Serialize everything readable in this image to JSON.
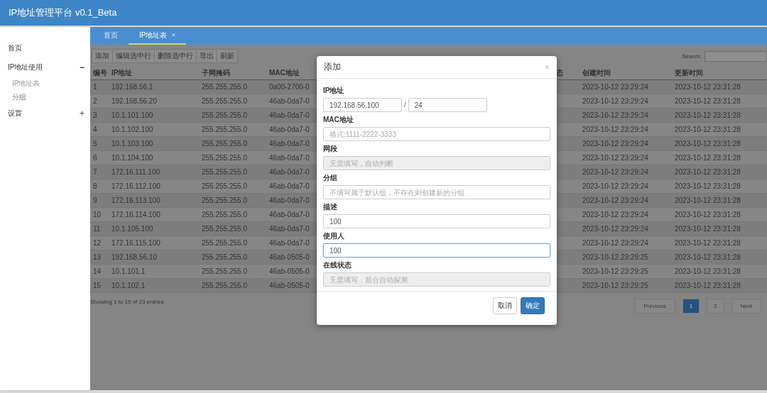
{
  "header": {
    "title": "IP地址管理平台 v0.1_Beta"
  },
  "sidebar": {
    "items": [
      {
        "label": "首页"
      },
      {
        "label": "IP地址使用",
        "expanded": true,
        "toggle": "−",
        "children": [
          {
            "label": "IP地址表",
            "selected": true
          },
          {
            "label": "分组",
            "selected": false
          }
        ]
      },
      {
        "label": "设置",
        "expanded": false,
        "toggle": "+"
      }
    ]
  },
  "tabs": [
    {
      "label": "首页",
      "selected": false
    },
    {
      "label": "IP地址表",
      "selected": true,
      "close": "×"
    }
  ],
  "toolbar": {
    "buttons": [
      "添加",
      "编辑选中行",
      "删除选中行",
      "导出",
      "刷新"
    ],
    "search_label": "Search:"
  },
  "table": {
    "columns": [
      "编号",
      "IP地址",
      "子网掩码",
      "MAC地址",
      "态",
      "创建时间",
      "更新时间"
    ],
    "rows": [
      {
        "id": "1",
        "ip": "192.168.56.1",
        "mask": "255.255.255.0",
        "mac": "0a00-2700-0",
        "created": "2023-10-12 23:29:24",
        "updated": "2023-10-12 23:31:28"
      },
      {
        "id": "2",
        "ip": "192.168.56.20",
        "mask": "255.255.255.0",
        "mac": "46ab-0da7-0",
        "created": "2023-10-12 23:29:24",
        "updated": "2023-10-12 23:31:28"
      },
      {
        "id": "3",
        "ip": "10.1.101.100",
        "mask": "255.255.255.0",
        "mac": "46ab-0da7-0",
        "created": "2023-10-12 23:29:24",
        "updated": "2023-10-12 23:31:28"
      },
      {
        "id": "4",
        "ip": "10.1.102.100",
        "mask": "255.255.255.0",
        "mac": "46ab-0da7-0",
        "created": "2023-10-12 23:29:24",
        "updated": "2023-10-12 23:31:28"
      },
      {
        "id": "5",
        "ip": "10.1.103.100",
        "mask": "255.255.255.0",
        "mac": "46ab-0da7-0",
        "created": "2023-10-12 23:29:24",
        "updated": "2023-10-12 23:31:28"
      },
      {
        "id": "6",
        "ip": "10.1.104.100",
        "mask": "255.255.255.0",
        "mac": "46ab-0da7-0",
        "created": "2023-10-12 23:29:24",
        "updated": "2023-10-12 23:31:28"
      },
      {
        "id": "7",
        "ip": "172.16.111.100",
        "mask": "255.255.255.0",
        "mac": "46ab-0da7-0",
        "created": "2023-10-12 23:29:24",
        "updated": "2023-10-12 23:31:28"
      },
      {
        "id": "8",
        "ip": "172.16.112.100",
        "mask": "255.255.255.0",
        "mac": "46ab-0da7-0",
        "created": "2023-10-12 23:29:24",
        "updated": "2023-10-12 23:31:28"
      },
      {
        "id": "9",
        "ip": "172.16.113.100",
        "mask": "255.255.255.0",
        "mac": "46ab-0da7-0",
        "created": "2023-10-12 23:29:24",
        "updated": "2023-10-12 23:31:28"
      },
      {
        "id": "10",
        "ip": "172.16.114.100",
        "mask": "255.255.255.0",
        "mac": "46ab-0da7-0",
        "created": "2023-10-12 23:29:24",
        "updated": "2023-10-12 23:31:28"
      },
      {
        "id": "11",
        "ip": "10.1.105.100",
        "mask": "255.255.255.0",
        "mac": "46ab-0da7-0",
        "created": "2023-10-12 23:29:24",
        "updated": "2023-10-12 23:31:28"
      },
      {
        "id": "12",
        "ip": "172.16.115.100",
        "mask": "255.255.255.0",
        "mac": "46ab-0da7-0",
        "created": "2023-10-12 23:29:24",
        "updated": "2023-10-12 23:31:28"
      },
      {
        "id": "13",
        "ip": "192.168.56.10",
        "mask": "255.255.255.0",
        "mac": "46ab-0505-0",
        "created": "2023-10-12 23:29:25",
        "updated": "2023-10-12 23:31:28"
      },
      {
        "id": "14",
        "ip": "10.1.101.1",
        "mask": "255.255.255.0",
        "mac": "46ab-0505-0",
        "created": "2023-10-12 23:29:25",
        "updated": "2023-10-12 23:31:28"
      },
      {
        "id": "15",
        "ip": "10.1.102.1",
        "mask": "255.255.255.0",
        "mac": "46ab-0505-0",
        "created": "2023-10-12 23:29:25",
        "updated": "2023-10-12 23:31:28"
      }
    ],
    "info": "Showing 1 to 15 of 23 entries"
  },
  "pagination": [
    {
      "label": "Previous",
      "kind": "nav",
      "selected": false
    },
    {
      "label": "1",
      "kind": "page",
      "selected": true
    },
    {
      "label": "2",
      "kind": "page",
      "selected": false
    },
    {
      "label": "Next",
      "kind": "nav",
      "selected": false
    }
  ],
  "dialog": {
    "title": "添加",
    "close": "×",
    "fields": [
      {
        "label": "IP地址",
        "kind": "ip",
        "value": "192.168.56.100",
        "separator": "/",
        "prefix_value": "24",
        "disabled": false,
        "focused": false
      },
      {
        "label": "MAC地址",
        "kind": "text",
        "placeholder": "格式:1111-2222-3333",
        "disabled": false,
        "focused": false
      },
      {
        "label": "网段",
        "kind": "text",
        "placeholder": "无需填写，自动判断",
        "disabled": true,
        "focused": false
      },
      {
        "label": "分组",
        "kind": "text",
        "placeholder": "不填写属于默认组，不存在则创建新的分组",
        "disabled": false,
        "focused": false
      },
      {
        "label": "描述",
        "kind": "text",
        "value": "100",
        "disabled": false,
        "focused": false
      },
      {
        "label": "使用人",
        "kind": "text",
        "value": "100",
        "disabled": false,
        "focused": true
      },
      {
        "label": "在线状态",
        "kind": "text",
        "placeholder": "无需填写，后台自动探测",
        "disabled": true,
        "focused": false
      }
    ],
    "buttons": [
      {
        "label": "取消",
        "kind": "default"
      },
      {
        "label": "确定",
        "kind": "primary"
      }
    ]
  }
}
